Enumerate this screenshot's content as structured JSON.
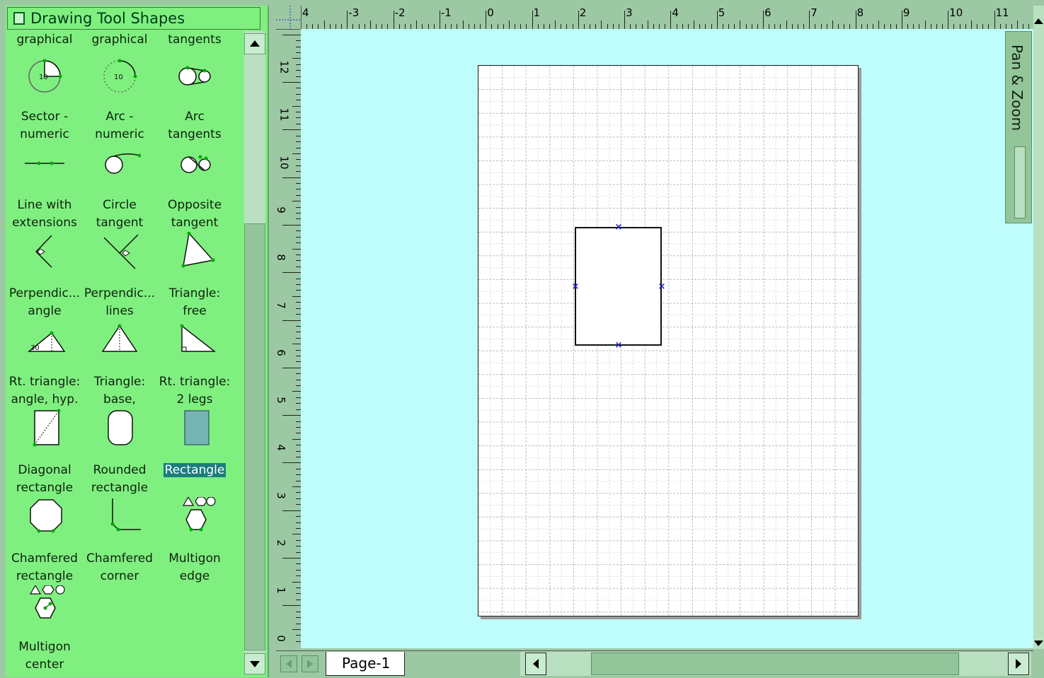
{
  "stencil": {
    "title": "Drawing Tool Shapes",
    "shapes": [
      {
        "name": "shape-graphical-1",
        "line1": "graphical",
        "line2": ""
      },
      {
        "name": "shape-graphical-2",
        "line1": "graphical",
        "line2": ""
      },
      {
        "name": "shape-tangents",
        "line1": "tangents",
        "line2": ""
      },
      {
        "name": "shape-sector-numeric",
        "line1": "Sector -",
        "line2": "numeric"
      },
      {
        "name": "shape-arc-numeric",
        "line1": "Arc -",
        "line2": "numeric"
      },
      {
        "name": "shape-arc-tangents",
        "line1": "Arc",
        "line2": "tangents"
      },
      {
        "name": "shape-line-with-extensions",
        "line1": "Line with",
        "line2": "extensions"
      },
      {
        "name": "shape-circle-tangent",
        "line1": "Circle",
        "line2": "tangent"
      },
      {
        "name": "shape-opposite-tangent",
        "line1": "Opposite",
        "line2": "tangent"
      },
      {
        "name": "shape-perpendicular-angle",
        "line1": "Perpendic...",
        "line2": "angle"
      },
      {
        "name": "shape-perpendicular-lines",
        "line1": "Perpendic...",
        "line2": "lines"
      },
      {
        "name": "shape-triangle-free",
        "line1": "Triangle:",
        "line2": "free"
      },
      {
        "name": "shape-rt-triangle-angle-hyp",
        "line1": "Rt. triangle:",
        "line2": "angle, hyp."
      },
      {
        "name": "shape-triangle-base",
        "line1": "Triangle:",
        "line2": "base,"
      },
      {
        "name": "shape-rt-triangle-2-legs",
        "line1": "Rt. triangle:",
        "line2": "2 legs"
      },
      {
        "name": "shape-diagonal-rectangle",
        "line1": "Diagonal",
        "line2": "rectangle"
      },
      {
        "name": "shape-rounded-rectangle",
        "line1": "Rounded",
        "line2": "rectangle"
      },
      {
        "name": "shape-rectangle",
        "line1": "Rectangle",
        "line2": ""
      },
      {
        "name": "shape-chamfered-rectangle",
        "line1": "Chamfered",
        "line2": "rectangle"
      },
      {
        "name": "shape-chamfered-corner",
        "line1": "Chamfered",
        "line2": "corner"
      },
      {
        "name": "shape-multigon-edge",
        "line1": "Multigon",
        "line2": "edge"
      },
      {
        "name": "shape-multigon-center",
        "line1": "Multigon",
        "line2": "center"
      }
    ],
    "selected_shape": "Rectangle",
    "sector_value": "10",
    "arc_value": "10",
    "angle_value": "30"
  },
  "rulers": {
    "horizontal": [
      "4",
      "-3",
      "-2",
      "-1",
      "0",
      "1",
      "2",
      "3",
      "4",
      "5",
      "6",
      "7",
      "8",
      "9",
      "10",
      "11"
    ],
    "vertical": [
      "12",
      "11",
      "10",
      "9",
      "8",
      "7",
      "6",
      "5",
      "4",
      "3",
      "2",
      "1",
      "0"
    ]
  },
  "panzoom": {
    "label": "Pan & Zoom"
  },
  "page_tab": {
    "label": "Page-1"
  },
  "colors": {
    "stencil_bg": "#7ff07f",
    "canvas_bg": "#bffcfc",
    "selection": "#1b7d7d",
    "handle": "#1a1ad6"
  }
}
